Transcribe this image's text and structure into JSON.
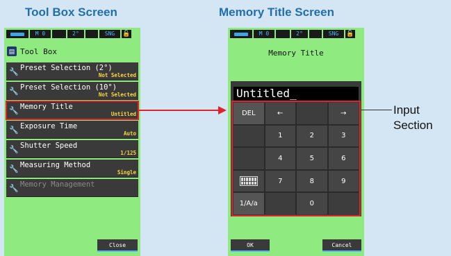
{
  "captions": {
    "left": "Tool Box Screen",
    "right": "Memory Title Screen"
  },
  "status_bar": {
    "memory": "M 0",
    "angle": "2°",
    "mode": "SNG",
    "lock": "🔓"
  },
  "toolbox": {
    "title": "Tool Box",
    "items": [
      {
        "label": "Preset Selection (2°)",
        "value": "Not Selected"
      },
      {
        "label": "Preset Selection (10°)",
        "value": "Not Selected"
      },
      {
        "label": "Memory Title",
        "value": "Untitled"
      },
      {
        "label": "Exposure Time",
        "value": "Auto"
      },
      {
        "label": "Shutter Speed",
        "value": "1/125"
      },
      {
        "label": "Measuring Method",
        "value": "Single"
      },
      {
        "label": "Memory Management",
        "value": ""
      }
    ],
    "close_label": "Close"
  },
  "memory_title": {
    "title": "Memory Title",
    "input_value": "Untitled_",
    "keys": [
      "DEL",
      "←",
      "",
      "→",
      "",
      "1",
      "2",
      "3",
      "",
      "4",
      "5",
      "6",
      "",
      "7",
      "8",
      "9",
      "1/A/a",
      "",
      "0",
      ""
    ],
    "ok_label": "OK",
    "cancel_label": "Cancel"
  },
  "callout": {
    "line1": "Input",
    "line2": "Section"
  },
  "colors": {
    "screen_bg": "#8fea7f",
    "highlight": "#e0222b",
    "value_yellow": "#ffd93b",
    "caption_blue": "#1f6fb0"
  }
}
